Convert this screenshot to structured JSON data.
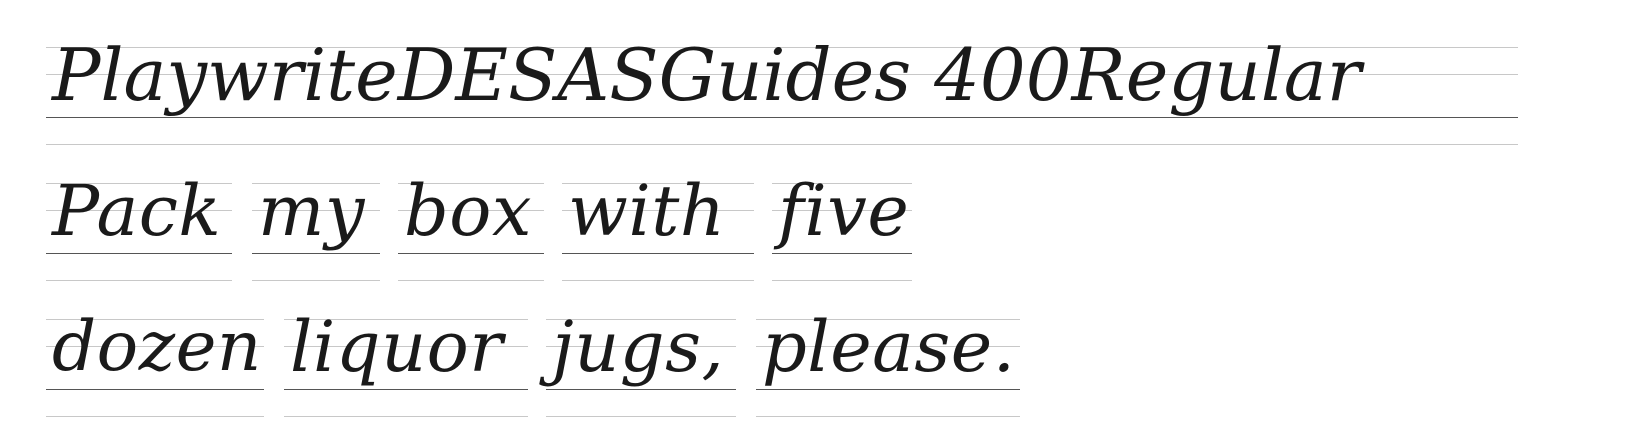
{
  "specimen": {
    "lines": [
      {
        "words": [
          "PlaywriteDESASGuides 400Regular"
        ]
      },
      {
        "words": [
          "Pack",
          "my",
          "box",
          "with",
          "five"
        ]
      },
      {
        "words": [
          "dozen",
          "liquor",
          "jugs,",
          "please."
        ]
      }
    ]
  },
  "colors": {
    "background": "#ffffff",
    "ink": "#1a1a1a",
    "guide": "#c8c8c8"
  }
}
